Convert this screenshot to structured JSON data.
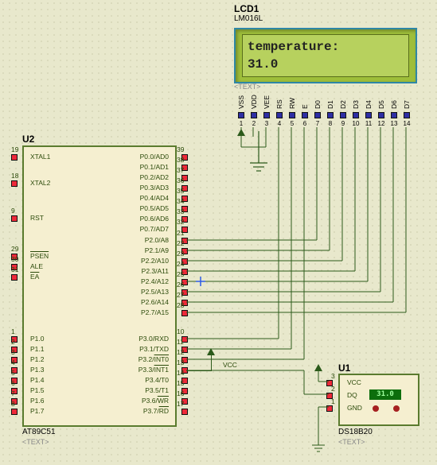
{
  "lcd": {
    "ref": "LCD1",
    "model": "LM016L",
    "line1": "temperature:",
    "line2": " 31.0",
    "pins": [
      {
        "name": "VSS",
        "num": "1"
      },
      {
        "name": "VDD",
        "num": "2"
      },
      {
        "name": "VEE",
        "num": "3"
      },
      {
        "name": "RS",
        "num": "4"
      },
      {
        "name": "RW",
        "num": "5"
      },
      {
        "name": "E",
        "num": "6"
      },
      {
        "name": "D0",
        "num": "7"
      },
      {
        "name": "D1",
        "num": "8"
      },
      {
        "name": "D2",
        "num": "9"
      },
      {
        "name": "D3",
        "num": "10"
      },
      {
        "name": "D4",
        "num": "11"
      },
      {
        "name": "D5",
        "num": "12"
      },
      {
        "name": "D6",
        "num": "13"
      },
      {
        "name": "D7",
        "num": "14"
      }
    ],
    "text_placeholder": "<TEXT>"
  },
  "mcu": {
    "ref": "U2",
    "model": "AT89C51",
    "text_placeholder": "<TEXT>",
    "left_pins": [
      {
        "label": "XTAL1",
        "num": "19"
      },
      {
        "label": "XTAL2",
        "num": "18"
      },
      {
        "label": "RST",
        "num": "9"
      },
      {
        "label": "PSEN",
        "num": "29",
        "bar": true
      },
      {
        "label": "ALE",
        "num": "30"
      },
      {
        "label": "EA",
        "num": "31",
        "bar": true
      },
      {
        "label": "P1.0",
        "num": "1"
      },
      {
        "label": "P1.1",
        "num": "2"
      },
      {
        "label": "P1.2",
        "num": "3"
      },
      {
        "label": "P1.3",
        "num": "4"
      },
      {
        "label": "P1.4",
        "num": "5"
      },
      {
        "label": "P1.5",
        "num": "6"
      },
      {
        "label": "P1.6",
        "num": "7"
      },
      {
        "label": "P1.7",
        "num": "8"
      }
    ],
    "port0": [
      {
        "l": "P0.0/AD0",
        "n": "39"
      },
      {
        "l": "P0.1/AD1",
        "n": "38"
      },
      {
        "l": "P0.2/AD2",
        "n": "37"
      },
      {
        "l": "P0.3/AD3",
        "n": "36"
      },
      {
        "l": "P0.4/AD4",
        "n": "35"
      },
      {
        "l": "P0.5/AD5",
        "n": "34"
      },
      {
        "l": "P0.6/AD6",
        "n": "33"
      },
      {
        "l": "P0.7/AD7",
        "n": "32"
      }
    ],
    "port2": [
      {
        "l": "P2.0/A8",
        "n": "21"
      },
      {
        "l": "P2.1/A9",
        "n": "22"
      },
      {
        "l": "P2.2/A10",
        "n": "23"
      },
      {
        "l": "P2.3/A11",
        "n": "24"
      },
      {
        "l": "P2.4/A12",
        "n": "25"
      },
      {
        "l": "P2.5/A13",
        "n": "26"
      },
      {
        "l": "P2.6/A14",
        "n": "27"
      },
      {
        "l": "P2.7/A15",
        "n": "28"
      }
    ],
    "port3": [
      {
        "l": "P3.0/RXD",
        "n": "10"
      },
      {
        "l": "P3.1/TXD",
        "n": "11"
      },
      {
        "l": "P3.2/INT0",
        "n": "12",
        "bar": "INT0"
      },
      {
        "l": "P3.3/INT1",
        "n": "13",
        "bar": "INT1"
      },
      {
        "l": "P3.4/T0",
        "n": "14"
      },
      {
        "l": "P3.5/T1",
        "n": "15"
      },
      {
        "l": "P3.6/WR",
        "n": "16",
        "bar": "WR"
      },
      {
        "l": "P3.7/RD",
        "n": "17",
        "bar": "RD"
      }
    ]
  },
  "sensor": {
    "ref": "U1",
    "model": "DS18B20",
    "reading": "31.0",
    "text_placeholder": "<TEXT>",
    "pins": [
      {
        "label": "VCC",
        "num": "3"
      },
      {
        "label": "DQ",
        "num": "2"
      },
      {
        "label": "GND",
        "num": "1"
      }
    ],
    "power_label": "VCC"
  }
}
